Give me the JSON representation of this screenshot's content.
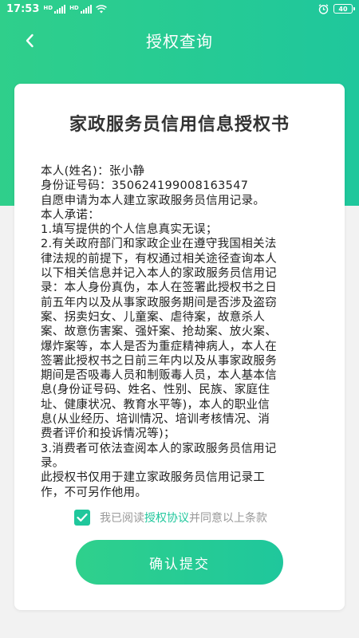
{
  "status_bar": {
    "time": "17:53",
    "signal_label": "HD",
    "battery": "40"
  },
  "header": {
    "title": "授权查询"
  },
  "document": {
    "title": "家政服务员信用信息授权书",
    "lines": [
      "本人(姓名)：张小静",
      "身份证号码：350624199008163547",
      "自愿申请为本人建立家政服务员信用记录。",
      "本人承诺：",
      "1.填写提供的个人信息真实无误；",
      "2.有关政府部门和家政企业在遵守我国相关法",
      "律法规的前提下，有权通过相关途径查询本人",
      "以下相关信息并记入本人的家政服务员信用记",
      "录：本人身份真伪，本人在签署此授权书之日",
      "前五年内以及从事家政服务期间是否涉及盗窃",
      "案、拐卖妇女、儿童案、虐待案，故意杀人",
      "案、故意伤害案、强奸案、抢劫案、放火案、",
      "爆炸案等，本人是否为重症精神病人，本人在",
      "签署此授权书之日前三年内以及从事家政服务",
      "期间是否吸毒人员和制贩毒人员，本人基本信",
      "息(身份证号码、姓名、性别、民族、家庭住",
      "址、健康状况、教育水平等)，本人的职业信",
      "息(从业经历、培训情况、培训考核情况、消",
      "费者评价和投诉情况等)；",
      "3.消费者可依法查阅本人的家政服务员信用记",
      "录。",
      "此授权书仅用于建立家政服务员信用记录工",
      "作，不可另作他用。"
    ]
  },
  "agreement": {
    "prefix": "我已阅读",
    "link": "授权协议",
    "suffix": "并同意以上条款",
    "checked": true
  },
  "submit": {
    "label": "确认提交"
  },
  "colors": {
    "accent": "#1fc79c",
    "accent_light": "#2fcf8b"
  }
}
